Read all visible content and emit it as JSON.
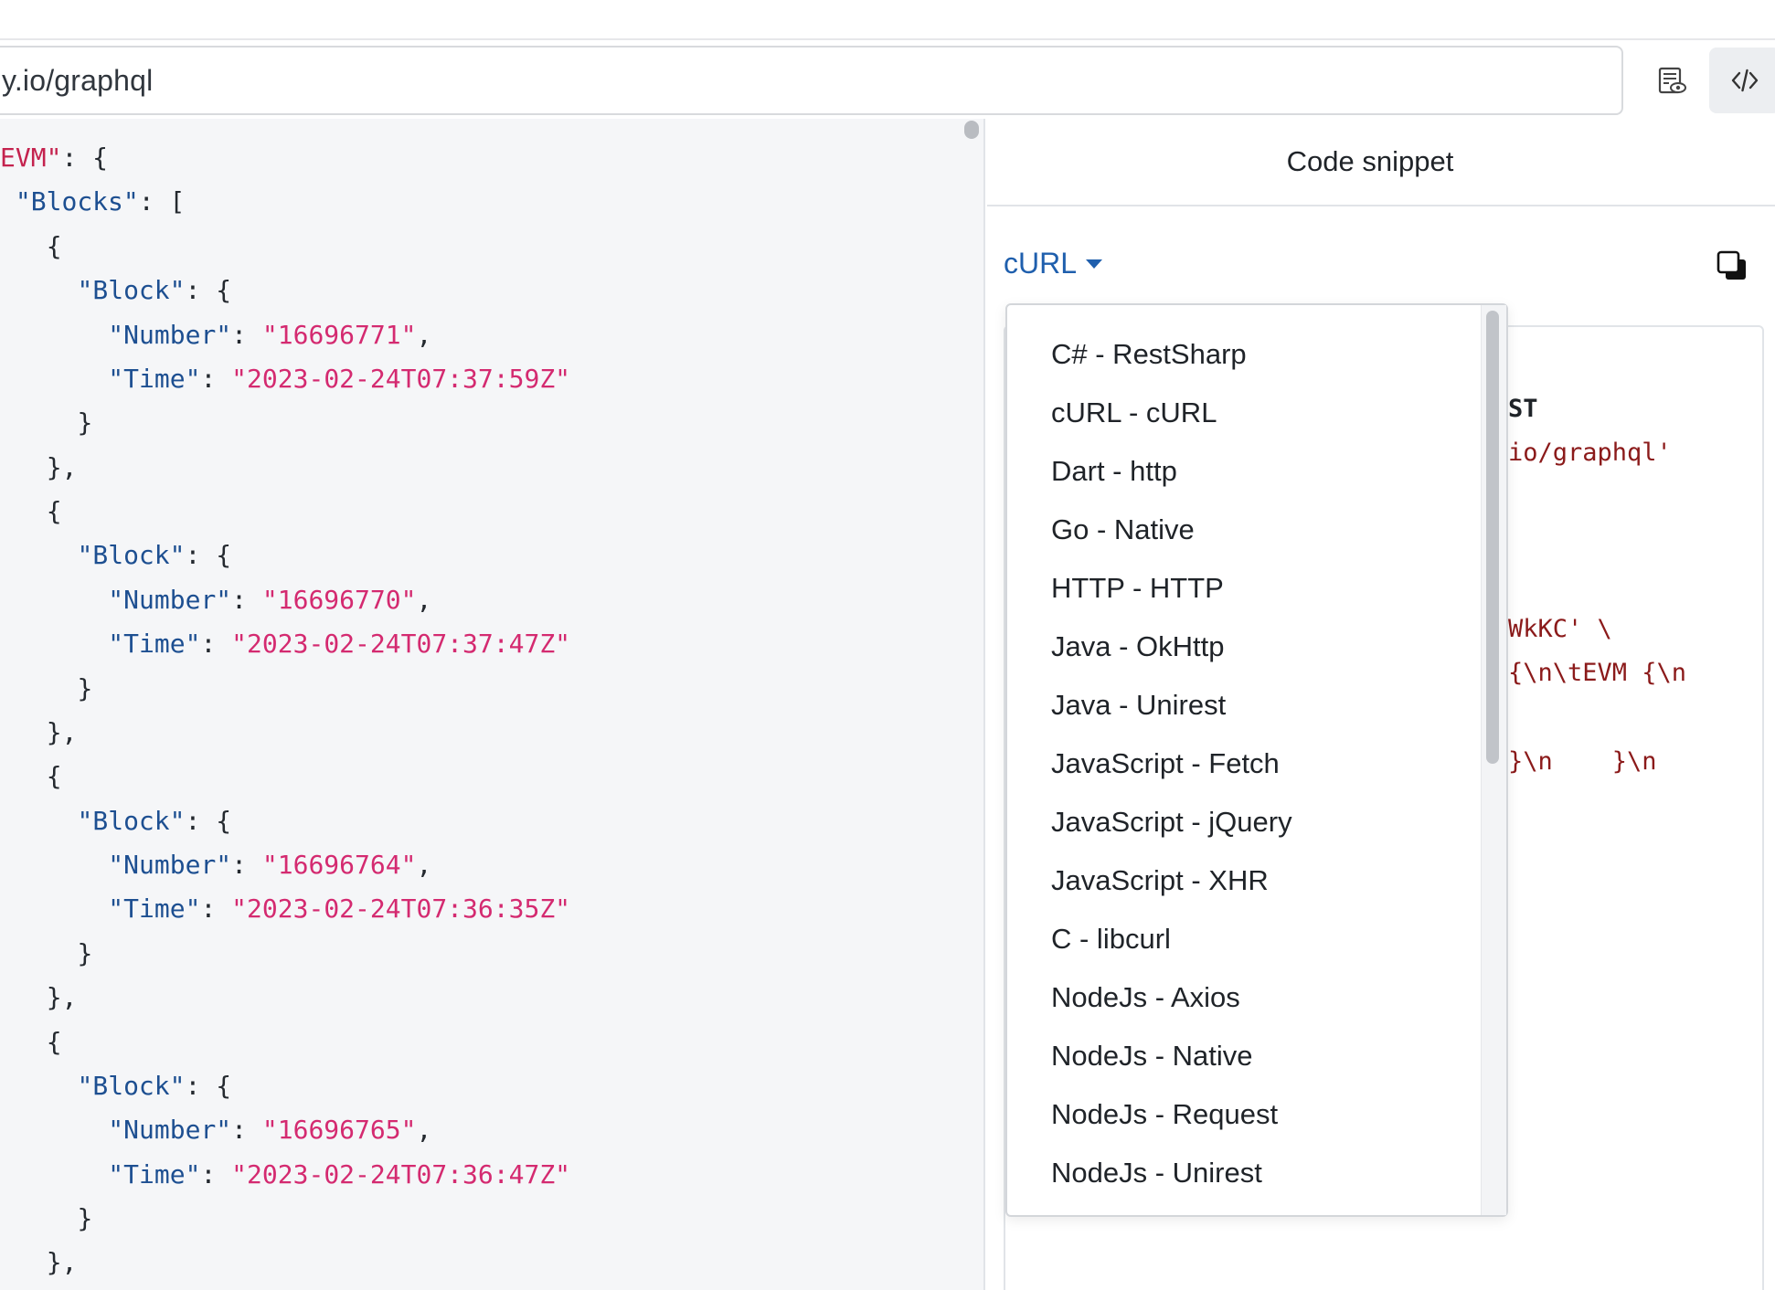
{
  "url_bar": {
    "value": "y.io/graphql"
  },
  "toolbar": {
    "preview_icon": "preview-doc-icon",
    "code_icon": "code-brackets-icon"
  },
  "response_json": [
    {
      "indent": "",
      "parts": [
        {
          "c": "ks",
          "t": "EVM\""
        },
        {
          "c": "p",
          "t": ": {"
        }
      ]
    },
    {
      "indent": " ",
      "parts": [
        {
          "c": "k",
          "t": "\"Blocks\""
        },
        {
          "c": "p",
          "t": ": ["
        }
      ]
    },
    {
      "indent": "   ",
      "parts": [
        {
          "c": "p",
          "t": "{"
        }
      ]
    },
    {
      "indent": "     ",
      "parts": [
        {
          "c": "k",
          "t": "\"Block\""
        },
        {
          "c": "p",
          "t": ": {"
        }
      ]
    },
    {
      "indent": "       ",
      "parts": [
        {
          "c": "k",
          "t": "\"Number\""
        },
        {
          "c": "p",
          "t": ": "
        },
        {
          "c": "v",
          "t": "\"16696771\""
        },
        {
          "c": "p",
          "t": ","
        }
      ]
    },
    {
      "indent": "       ",
      "parts": [
        {
          "c": "k",
          "t": "\"Time\""
        },
        {
          "c": "p",
          "t": ": "
        },
        {
          "c": "v",
          "t": "\"2023-02-24T07:37:59Z\""
        }
      ]
    },
    {
      "indent": "     ",
      "parts": [
        {
          "c": "p",
          "t": "}"
        }
      ]
    },
    {
      "indent": "   ",
      "parts": [
        {
          "c": "p",
          "t": "},"
        }
      ]
    },
    {
      "indent": "   ",
      "parts": [
        {
          "c": "p",
          "t": "{"
        }
      ]
    },
    {
      "indent": "     ",
      "parts": [
        {
          "c": "k",
          "t": "\"Block\""
        },
        {
          "c": "p",
          "t": ": {"
        }
      ]
    },
    {
      "indent": "       ",
      "parts": [
        {
          "c": "k",
          "t": "\"Number\""
        },
        {
          "c": "p",
          "t": ": "
        },
        {
          "c": "v",
          "t": "\"16696770\""
        },
        {
          "c": "p",
          "t": ","
        }
      ]
    },
    {
      "indent": "       ",
      "parts": [
        {
          "c": "k",
          "t": "\"Time\""
        },
        {
          "c": "p",
          "t": ": "
        },
        {
          "c": "v",
          "t": "\"2023-02-24T07:37:47Z\""
        }
      ]
    },
    {
      "indent": "     ",
      "parts": [
        {
          "c": "p",
          "t": "}"
        }
      ]
    },
    {
      "indent": "   ",
      "parts": [
        {
          "c": "p",
          "t": "},"
        }
      ]
    },
    {
      "indent": "   ",
      "parts": [
        {
          "c": "p",
          "t": "{"
        }
      ]
    },
    {
      "indent": "     ",
      "parts": [
        {
          "c": "k",
          "t": "\"Block\""
        },
        {
          "c": "p",
          "t": ": {"
        }
      ]
    },
    {
      "indent": "       ",
      "parts": [
        {
          "c": "k",
          "t": "\"Number\""
        },
        {
          "c": "p",
          "t": ": "
        },
        {
          "c": "v",
          "t": "\"16696764\""
        },
        {
          "c": "p",
          "t": ","
        }
      ]
    },
    {
      "indent": "       ",
      "parts": [
        {
          "c": "k",
          "t": "\"Time\""
        },
        {
          "c": "p",
          "t": ": "
        },
        {
          "c": "v",
          "t": "\"2023-02-24T07:36:35Z\""
        }
      ]
    },
    {
      "indent": "     ",
      "parts": [
        {
          "c": "p",
          "t": "}"
        }
      ]
    },
    {
      "indent": "   ",
      "parts": [
        {
          "c": "p",
          "t": "},"
        }
      ]
    },
    {
      "indent": "   ",
      "parts": [
        {
          "c": "p",
          "t": "{"
        }
      ]
    },
    {
      "indent": "     ",
      "parts": [
        {
          "c": "k",
          "t": "\"Block\""
        },
        {
          "c": "p",
          "t": ": {"
        }
      ]
    },
    {
      "indent": "       ",
      "parts": [
        {
          "c": "k",
          "t": "\"Number\""
        },
        {
          "c": "p",
          "t": ": "
        },
        {
          "c": "v",
          "t": "\"16696765\""
        },
        {
          "c": "p",
          "t": ","
        }
      ]
    },
    {
      "indent": "       ",
      "parts": [
        {
          "c": "k",
          "t": "\"Time\""
        },
        {
          "c": "p",
          "t": ": "
        },
        {
          "c": "v",
          "t": "\"2023-02-24T07:36:47Z\""
        }
      ]
    },
    {
      "indent": "     ",
      "parts": [
        {
          "c": "p",
          "t": "}"
        }
      ]
    },
    {
      "indent": "   ",
      "parts": [
        {
          "c": "p",
          "t": "},"
        }
      ]
    }
  ],
  "snippet_panel": {
    "title": "Code snippet",
    "selected_language": "cURL",
    "copy_icon": "copy-icon",
    "code_lines": [
      {
        "text": "ST",
        "style": "dark"
      },
      {
        "text": "io/graphql'",
        "style": "str"
      },
      {
        "text": "",
        "style": "str"
      },
      {
        "text": "",
        "style": "str"
      },
      {
        "text": "",
        "style": "str"
      },
      {
        "text": "WkKC' \\",
        "style": "str"
      },
      {
        "text": "{\\n\\tEVM {\\n",
        "style": "str"
      },
      {
        "text": "",
        "style": "str"
      },
      {
        "text": "}\\n    }\\n",
        "style": "str"
      }
    ]
  },
  "language_menu": {
    "items": [
      "C# - RestSharp",
      "cURL - cURL",
      "Dart - http",
      "Go - Native",
      "HTTP - HTTP",
      "Java - OkHttp",
      "Java - Unirest",
      "JavaScript - Fetch",
      "JavaScript - jQuery",
      "JavaScript - XHR",
      "C - libcurl",
      "NodeJs - Axios",
      "NodeJs - Native",
      "NodeJs - Request",
      "NodeJs - Unirest"
    ]
  },
  "colors": {
    "link": "#1f5fad",
    "json_key": "#1d4f91",
    "json_string": "#d42a70",
    "code_string": "#8b1a1a"
  }
}
